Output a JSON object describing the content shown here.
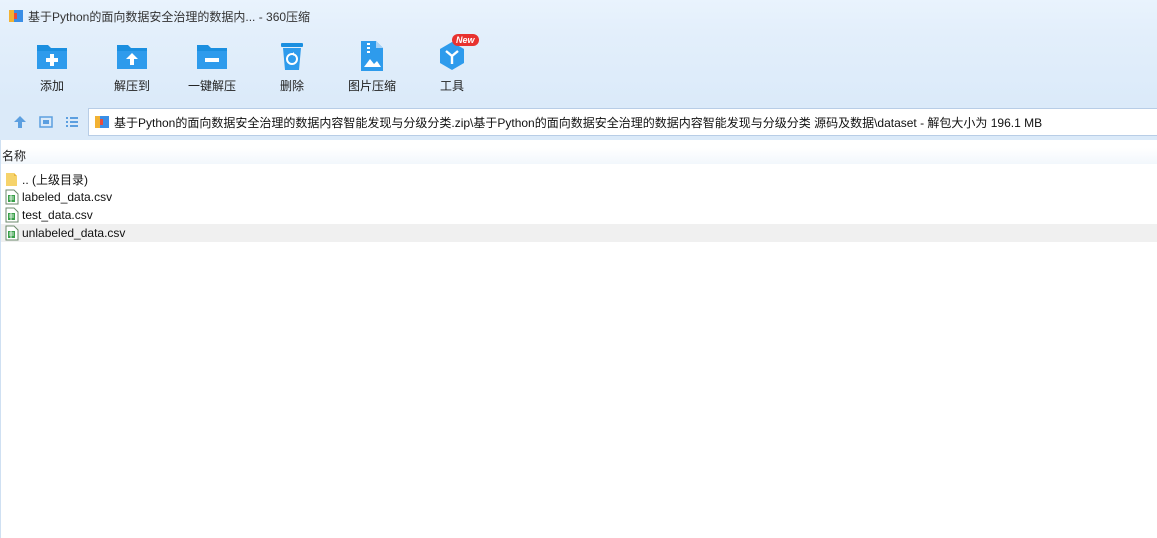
{
  "window": {
    "title": "基于Python的面向数据安全治理的数据内... - 360压缩"
  },
  "toolbar": {
    "items": [
      {
        "label": "添加",
        "icon": "add-icon"
      },
      {
        "label": "解压到",
        "icon": "extract-to-icon"
      },
      {
        "label": "一键解压",
        "icon": "one-click-extract-icon"
      },
      {
        "label": "删除",
        "icon": "delete-icon"
      },
      {
        "label": "图片压缩",
        "icon": "image-compress-icon"
      },
      {
        "label": "工具",
        "icon": "tools-icon",
        "badge": "New"
      }
    ]
  },
  "address": {
    "path": "基于Python的面向数据安全治理的数据内容智能发现与分级分类.zip\\基于Python的面向数据安全治理的数据内容智能发现与分级分类 源码及数据\\dataset - 解包大小为 196.1 MB"
  },
  "list": {
    "column_name": "名称",
    "rows": [
      {
        "name": ".. (上级目录)",
        "icon": "folder-icon"
      },
      {
        "name": "labeled_data.csv",
        "icon": "csv-file-icon"
      },
      {
        "name": "test_data.csv",
        "icon": "csv-file-icon"
      },
      {
        "name": "unlabeled_data.csv",
        "icon": "csv-file-icon"
      }
    ]
  },
  "colors": {
    "accent": "#1b8fe0",
    "toolbar_bg": "#dbeaf9",
    "badge": "#e8322f"
  }
}
